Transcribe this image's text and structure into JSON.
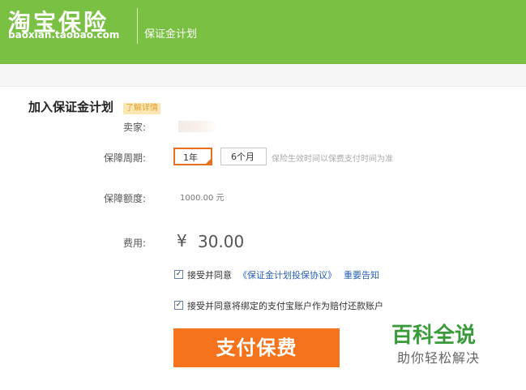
{
  "header": {
    "logo_cn": "淘宝保险",
    "logo_en": "baoxian.taobao.com",
    "subtitle": "保证金计划"
  },
  "form": {
    "title": "加入保证金计划",
    "tip": "了解详情",
    "seller_label": "卖家:",
    "period_label": "保障周期:",
    "period_options": [
      "1年",
      "6个月"
    ],
    "period_selected": "1年",
    "period_hint": "保险生效时间以保费支付时间为准",
    "amount_label": "保障额度:",
    "amount_value": "1000.00 元",
    "fee_label": "费用:",
    "fee_currency": "¥",
    "fee_value": "30.00",
    "agree1_text": "接受并同意",
    "agree1_link": "《保证金计划投保协议》",
    "agree1_notice": "重要告知",
    "agree2_text": "接受并同意将绑定的支付宝账户作为赔付还款账户",
    "pay_button": "支付保费"
  },
  "watermark": {
    "title": "百科全说",
    "subtitle": "助你轻松解决"
  },
  "colors": {
    "header_green": "#7ac043",
    "accent_orange": "#f4731c",
    "link_blue": "#2a62b8",
    "watermark_green": "#3a9b3a"
  }
}
